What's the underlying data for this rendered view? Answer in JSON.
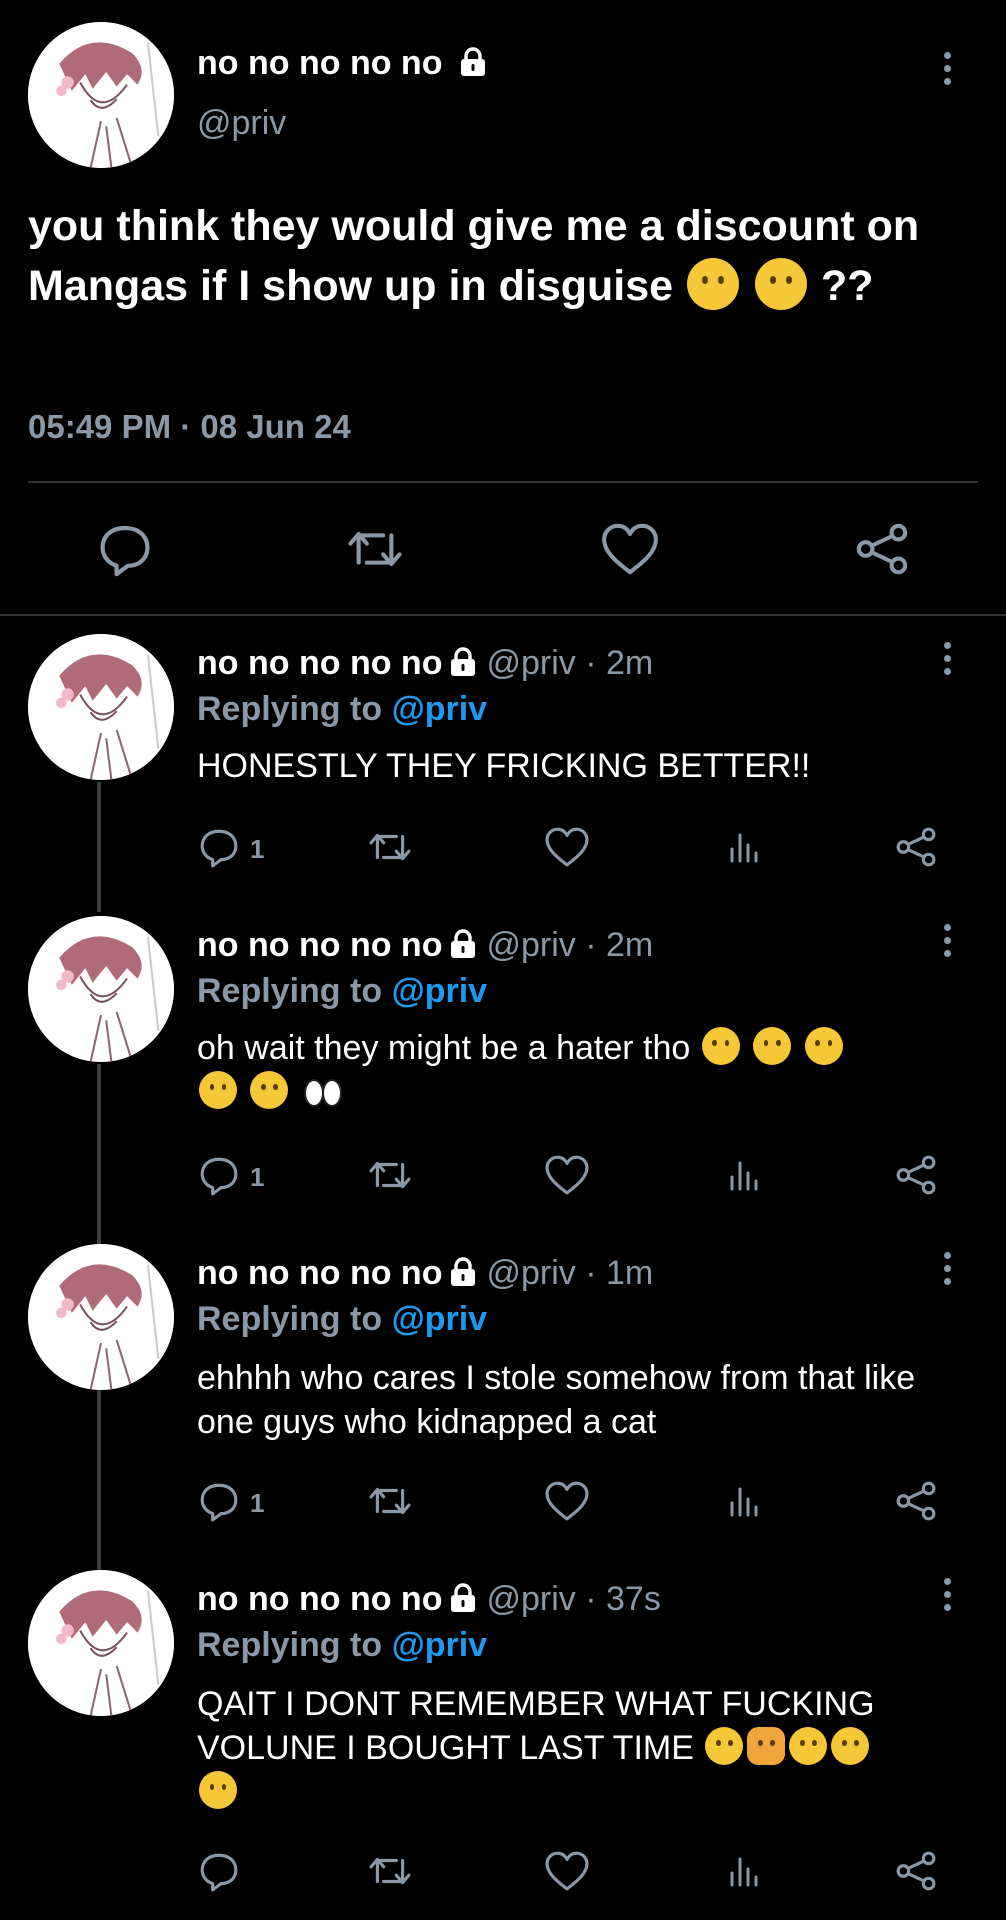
{
  "main_tweet": {
    "name": "no no no no no",
    "handle": "@priv",
    "text": "you think they would give me a discount on Mangas if I show up in disguise",
    "text_tail": "??",
    "timestamp": "05:49 PM · 08 Jun 24"
  },
  "replies": [
    {
      "name": "no no no no no",
      "meta": "@priv · 2m",
      "replying_prefix": "Replying to",
      "replying_to": "@priv",
      "text": "HONESTLY THEY FRICKING BETTER!!",
      "reply_count": "1"
    },
    {
      "name": "no no no no no",
      "meta": "@priv · 2m",
      "replying_prefix": "Replying to",
      "replying_to": "@priv",
      "text": "oh wait they might be a hater tho",
      "reply_count": "1"
    },
    {
      "name": "no no no no no",
      "meta": "@priv · 1m",
      "replying_prefix": "Replying to",
      "replying_to": "@priv",
      "text": "ehhhh who cares I stole somehow from that like one guys who kidnapped a cat",
      "reply_count": "1"
    },
    {
      "name": "no no no no no",
      "meta": "@priv · 37s",
      "replying_prefix": "Replying to",
      "replying_to": "@priv",
      "text": "QAIT I DONT REMEMBER WHAT FUCKING VOLUNE I BOUGHT LAST TIME",
      "reply_count": ""
    }
  ],
  "icons": [
    "lock-icon",
    "more-icon",
    "reply-icon",
    "retweet-icon",
    "like-icon",
    "share-icon",
    "views-icon"
  ],
  "colors": {
    "background": "#000000",
    "text": "#e7e9ea",
    "muted": "#8b98a5",
    "link": "#1d9bf0",
    "divider": "#2f3336"
  }
}
